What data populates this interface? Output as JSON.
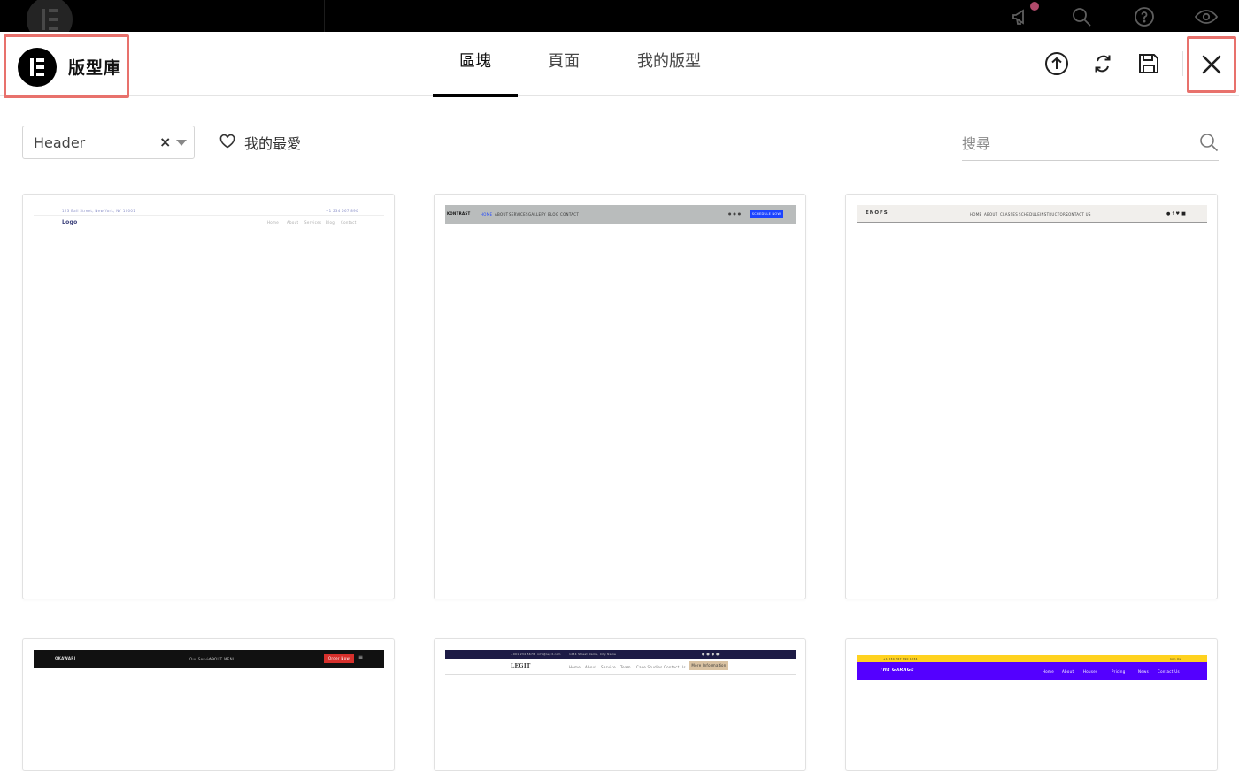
{
  "top_bar": {
    "icons": [
      "megaphone-icon",
      "search-icon",
      "help-icon",
      "eye-icon"
    ]
  },
  "library": {
    "title": "版型庫",
    "tabs": [
      {
        "label": "區塊",
        "active": true
      },
      {
        "label": "頁面",
        "active": false
      },
      {
        "label": "我的版型",
        "active": false
      }
    ],
    "actions": [
      "upload-icon",
      "sync-icon",
      "save-icon",
      "close-icon"
    ]
  },
  "filters": {
    "category_value": "Header",
    "favorites_label": "我的最愛",
    "search_placeholder": "搜尋"
  },
  "templates": [
    {
      "name": "template-1",
      "topline_left": "123 Bali Street, New York, NY 10001",
      "topline_right": "+1 234 567 890",
      "logo": "Logo",
      "nav": [
        "Home",
        "About",
        "Services",
        "Blog",
        "Contact"
      ]
    },
    {
      "name": "template-2",
      "logo": "KONTRAST",
      "nav": [
        "HOME",
        "ABOUT",
        "SERVICES",
        "GALLERY",
        "BLOG",
        "CONTACT"
      ],
      "cta": "SCHEDULE NOW",
      "bar_color": "#b9bcbc",
      "cta_color": "#1c44ff"
    },
    {
      "name": "template-3",
      "logo": "ENOFS",
      "nav": [
        "HOME",
        "ABOUT",
        "CLASSES",
        "SCHEDULE",
        "INSTRUCTORS",
        "CONTACT US"
      ],
      "bar_color": "#f1efec"
    },
    {
      "name": "template-4",
      "logo": "OKAWARI",
      "nav": [
        "Our Services",
        "ABOUT MENU"
      ],
      "cta": "Order Now",
      "bar_color": "#111111",
      "cta_color": "#d6302c"
    },
    {
      "name": "template-5",
      "topline": [
        "+001 234 5678",
        "info@legit.com",
        "1234 Street Name, City Name"
      ],
      "logo": "LEGIT",
      "nav": [
        "Home",
        "About",
        "Service",
        "Team",
        "Case Studies",
        "Contact Us"
      ],
      "cta": "More Information",
      "top_color": "#1d1b45",
      "cta_color": "#d9c2a2"
    },
    {
      "name": "template-6",
      "topline_left": "+1 234 567 890 1234",
      "topline_right": "Join Us",
      "logo": "THE GARAGE",
      "nav": [
        "Home",
        "About",
        "Houses",
        "Pricing",
        "News",
        "Contact Us"
      ],
      "top_color": "#ffd21f",
      "bar_color": "#5400ff"
    }
  ]
}
